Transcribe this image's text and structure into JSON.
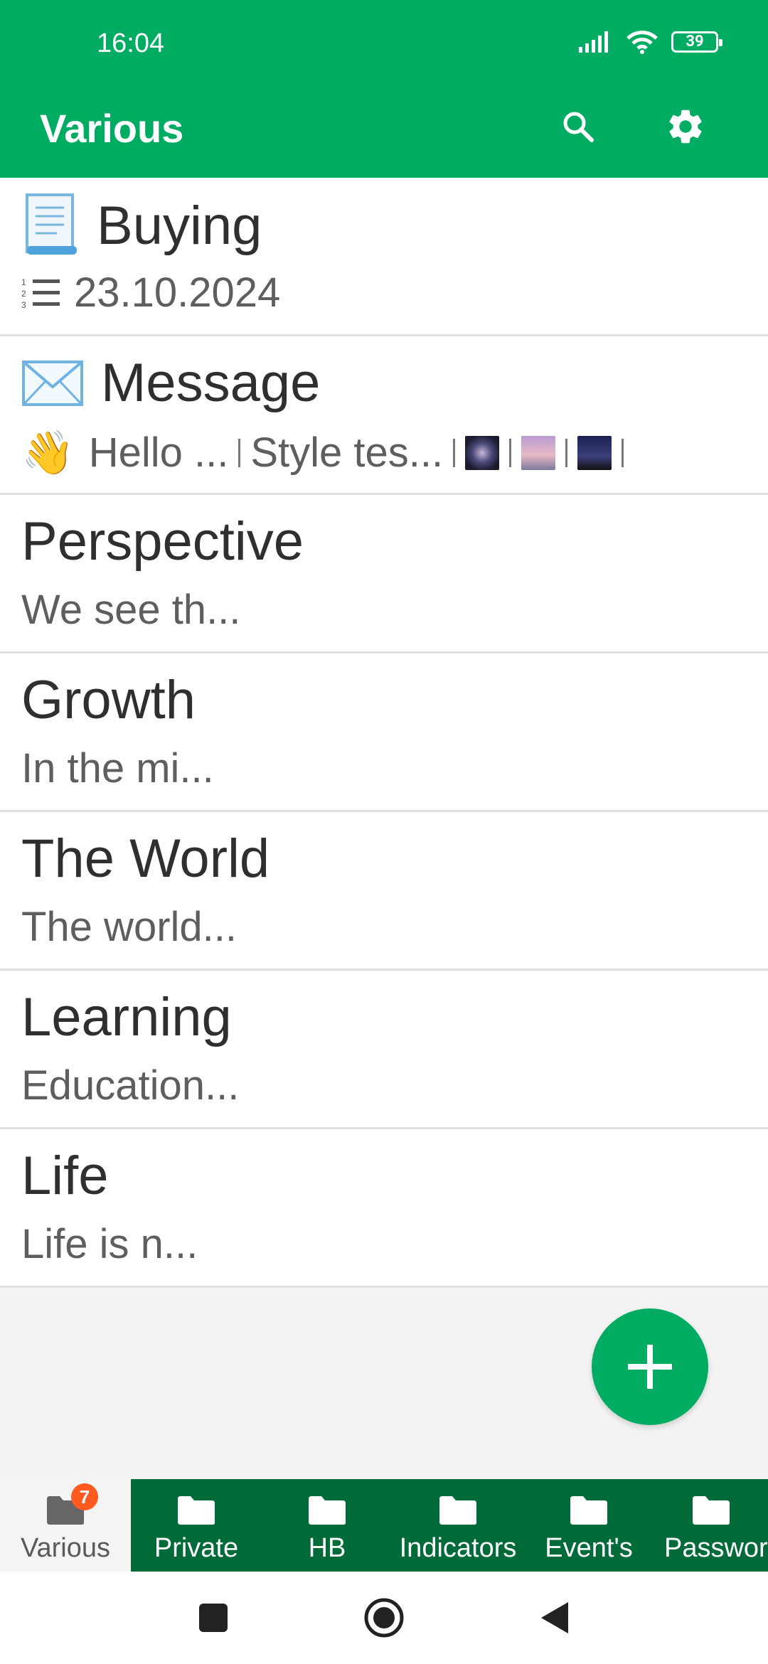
{
  "status": {
    "time": "16:04",
    "battery": "39"
  },
  "appbar": {
    "title": "Various"
  },
  "notes": [
    {
      "title": "Buying",
      "subtitle": "23.10.2024"
    },
    {
      "title": "Message",
      "items": [
        "Hello ...",
        "Style tes..."
      ]
    },
    {
      "title": "Perspective",
      "subtitle": "We see th..."
    },
    {
      "title": "Growth",
      "subtitle": "In the mi..."
    },
    {
      "title": "The World",
      "subtitle": "The world..."
    },
    {
      "title": "Learning",
      "subtitle": "Education..."
    },
    {
      "title": "Life",
      "subtitle": "Life is n..."
    }
  ],
  "tabs": [
    {
      "label": "Various",
      "badge": "7"
    },
    {
      "label": "Private"
    },
    {
      "label": "HB"
    },
    {
      "label": "Indicators"
    },
    {
      "label": "Event's"
    },
    {
      "label": "Passwords"
    }
  ],
  "colors": {
    "primary": "#00ab62",
    "tabbar": "#006b39",
    "badge": "#ff5a1f"
  }
}
